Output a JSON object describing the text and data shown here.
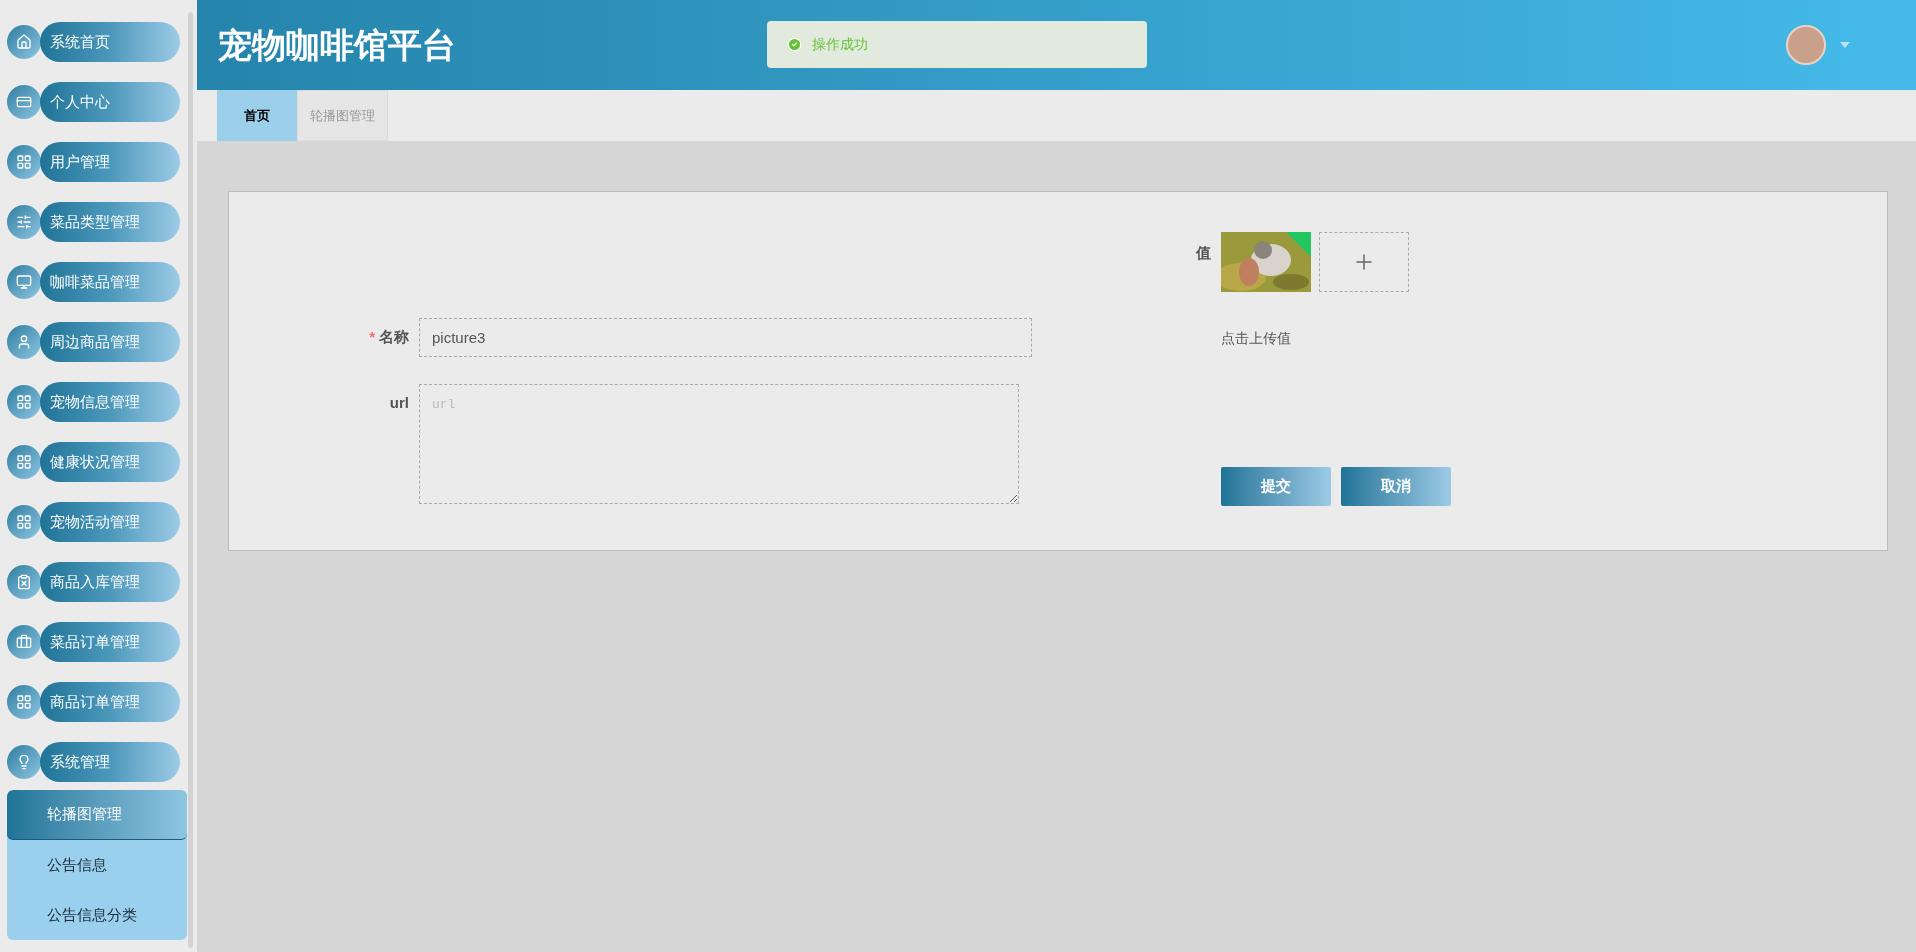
{
  "sidebar": {
    "items": [
      {
        "label": "系统首页"
      },
      {
        "label": "个人中心"
      },
      {
        "label": "用户管理"
      },
      {
        "label": "菜品类型管理"
      },
      {
        "label": "咖啡菜品管理"
      },
      {
        "label": "周边商品管理"
      },
      {
        "label": "宠物信息管理"
      },
      {
        "label": "健康状况管理"
      },
      {
        "label": "宠物活动管理"
      },
      {
        "label": "商品入库管理"
      },
      {
        "label": "菜品订单管理"
      },
      {
        "label": "商品订单管理"
      },
      {
        "label": "系统管理",
        "children": [
          {
            "label": "轮播图管理",
            "selected": true
          },
          {
            "label": "公告信息",
            "selected": false
          },
          {
            "label": "公告信息分类",
            "selected": false
          }
        ]
      }
    ]
  },
  "header": {
    "title": "宠物咖啡馆平台"
  },
  "toast": {
    "message": "操作成功"
  },
  "tabs": [
    {
      "label": "首页",
      "selected": true
    },
    {
      "label": "轮播图管理",
      "selected": false
    }
  ],
  "form": {
    "name_field": {
      "label": "名称",
      "required_mark": "*",
      "value": "picture3"
    },
    "url_field": {
      "label": "url",
      "placeholder": "url"
    },
    "value_field": {
      "label": "值",
      "hint": "点击上传值"
    },
    "buttons": [
      "提交",
      "取消"
    ]
  }
}
